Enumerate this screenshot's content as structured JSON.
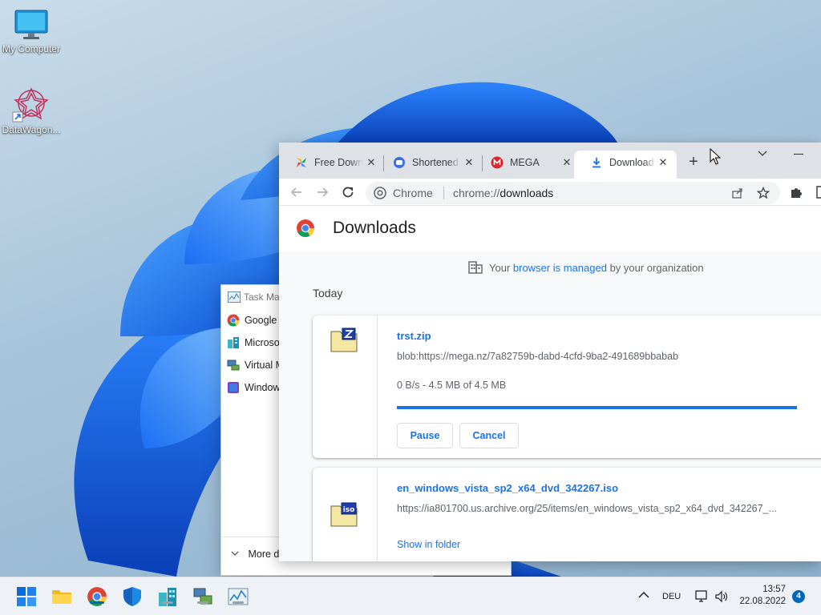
{
  "desktop": {
    "icons": [
      {
        "label": "My Computer",
        "icon": "monitor-icon"
      },
      {
        "label": "DataWagon...",
        "icon": "datawagon-shortcut-icon"
      }
    ]
  },
  "task_manager": {
    "title": "Task Ma",
    "apps": [
      "Google C",
      "Microsot",
      "Virtual M",
      "Window"
    ],
    "more_details": "More d"
  },
  "chrome": {
    "tabs": [
      {
        "label": "Free Down",
        "icon": "pinwheel-icon",
        "active": false
      },
      {
        "label": "Shortened",
        "icon": "link-shortener-icon",
        "active": false
      },
      {
        "label": "MEGA",
        "icon": "mega-icon",
        "active": false
      },
      {
        "label": "Download",
        "icon": "download-icon",
        "active": true
      }
    ],
    "omnibox": {
      "site": "Chrome",
      "url_scheme": "chrome://",
      "url_host": "downloads"
    }
  },
  "downloads_page": {
    "title": "Downloads",
    "managed_prefix": "Your ",
    "managed_link": "browser is managed",
    "managed_suffix": " by your organization",
    "section": "Today",
    "items": [
      {
        "name": "trst.zip",
        "source": "blob:https://mega.nz/7a82759b-dabd-4cfd-9ba2-491689bbabab",
        "status": "0 B/s - 4.5 MB of 4.5 MB",
        "progress": 1.0,
        "buttons": [
          "Pause",
          "Cancel"
        ],
        "file_icon": "zip-file-icon"
      },
      {
        "name": "en_windows_vista_sp2_x64_dvd_342267.iso",
        "source": "https://ia801700.us.archive.org/25/items/en_windows_vista_sp2_x64_dvd_342267_...",
        "link": "Show in folder",
        "file_icon": "iso-file-icon"
      }
    ]
  },
  "taskbar": {
    "apps": [
      "start",
      "file-explorer",
      "chrome",
      "defender",
      "buildings-app",
      "network-app",
      "task-manager"
    ],
    "language": "DEU",
    "time": "13:57",
    "date": "22.08.2022",
    "notifications": "4"
  },
  "colors": {
    "accent": "#1a73e8",
    "taskbar_accent": "#0067c0",
    "tabstrip": "#dee1e6"
  }
}
